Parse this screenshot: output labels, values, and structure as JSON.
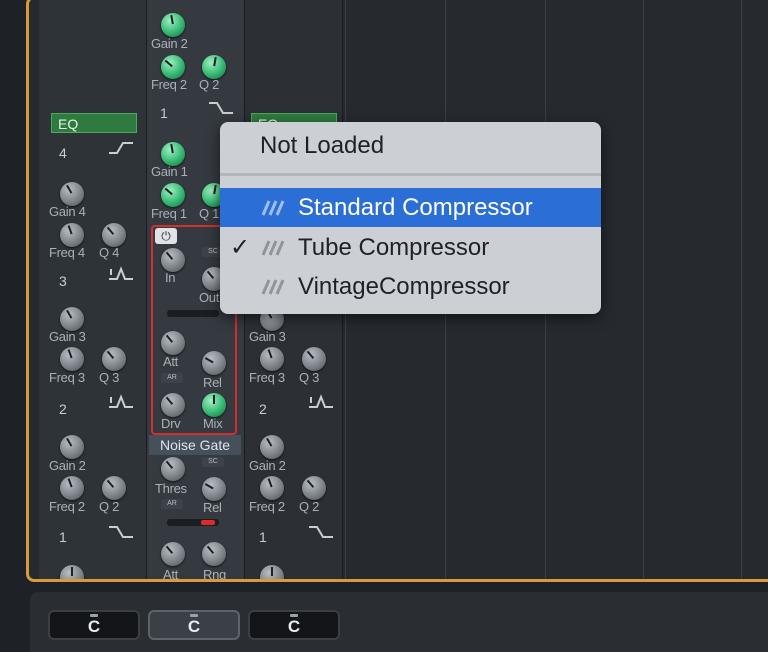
{
  "strip1": {
    "eq_tag": "EQ",
    "band_4": "4",
    "gain4": "Gain 4",
    "freq4": "Freq 4",
    "q4": "Q 4",
    "band_3": "3",
    "gain3": "Gain 3",
    "freq3": "Freq 3",
    "q3": "Q 3",
    "band_2": "2",
    "gain2": "Gain 2",
    "freq2": "Freq 2",
    "q2": "Q 2",
    "band_1": "1"
  },
  "strip2": {
    "gain2": "Gain 2",
    "freq2": "Freq 2",
    "q2": "Q 2",
    "band_1": "1",
    "gain1": "Gain 1",
    "freq1": "Freq 1",
    "q1": "Q 1",
    "comp_in": "In",
    "comp_out": "Out",
    "comp_att": "Att",
    "comp_rel": "Rel",
    "comp_drv": "Drv",
    "comp_mix": "Mix",
    "noise_gate": "Noise Gate",
    "ng_thres": "Thres",
    "ng_rel": "Rel",
    "ng_att": "Att",
    "ng_rng": "Rng"
  },
  "strip3": {
    "eq_tag": "EQ",
    "gain3": "Gain 3",
    "freq3": "Freq 3",
    "q3": "Q 3",
    "band_2": "2",
    "gain2": "Gain 2",
    "freq2": "Freq 2",
    "q2": "Q 2",
    "band_1": "1"
  },
  "footer": {
    "pan_1": "C",
    "pan_2": "C",
    "pan_3": "C"
  },
  "menu": {
    "header": "Not Loaded",
    "items": [
      {
        "label": "Standard Compressor",
        "checked": false,
        "highlighted": true
      },
      {
        "label": "Tube Compressor",
        "checked": true,
        "highlighted": false
      },
      {
        "label": "VintageCompressor",
        "checked": false,
        "highlighted": false
      }
    ],
    "check_glyph": "✓"
  },
  "colors": {
    "accent_border": "#d89a3c",
    "menu_highlight": "#2b6fd6",
    "eq_tag": "#2f7a3e",
    "knob_green": "#35b873",
    "plugin_outline": "#d0312f"
  }
}
